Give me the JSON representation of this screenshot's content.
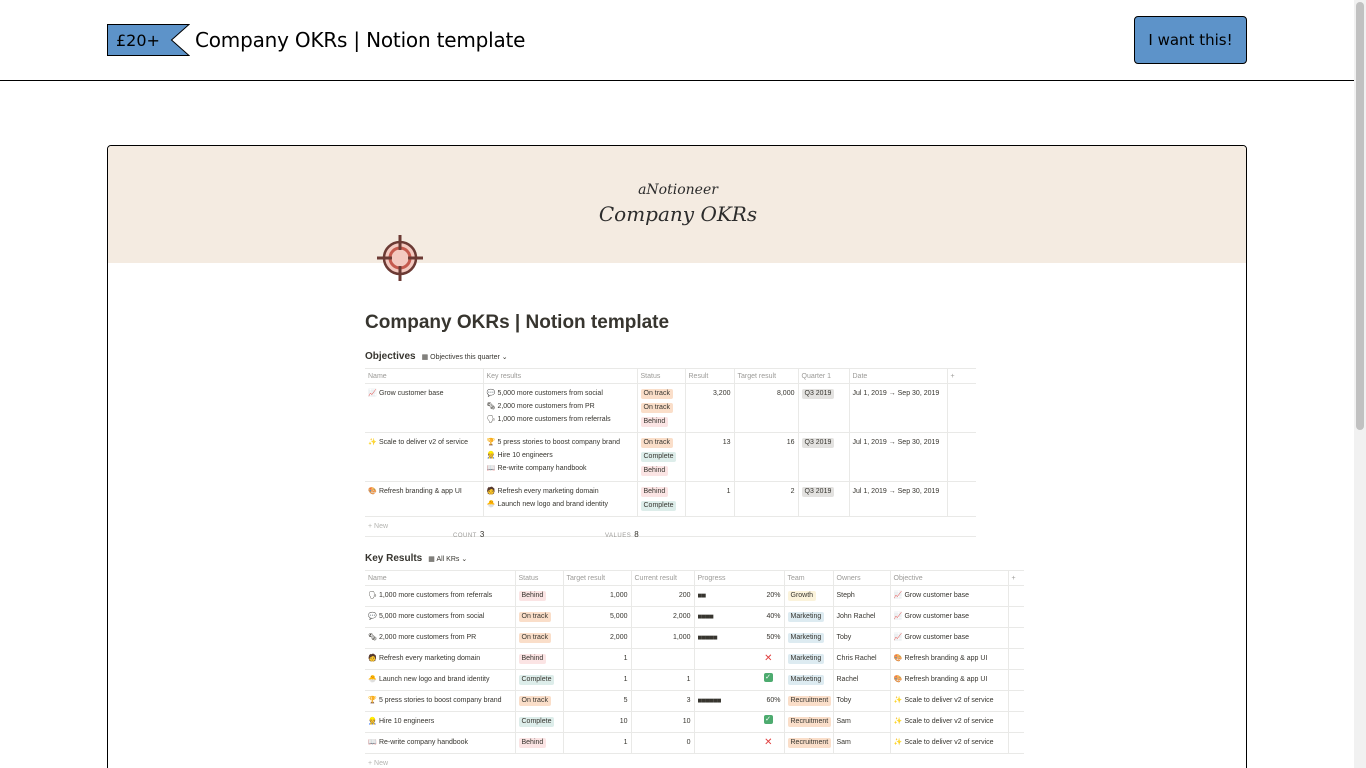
{
  "header": {
    "price": "£20+",
    "title": "Company OKRs | Notion template",
    "cta_label": "I want this!"
  },
  "colors": {
    "accent": "#5d93c9",
    "cover": "#f4ebe1",
    "behind": "#fbe4e4",
    "on_track": "#fadec9",
    "complete": "#ddedea"
  },
  "preview": {
    "cover_brand": "aNotioneer",
    "cover_title": "Company OKRs",
    "page_icon": "target-crosshair-icon",
    "page_title": "Company OKRs | Notion template",
    "objectives": {
      "name": "Objectives",
      "view": "Objectives this quarter",
      "columns": [
        "Name",
        "Key results",
        "Status",
        "Result",
        "Target result",
        "Quarter 1",
        "Date",
        "+"
      ],
      "rows": [
        {
          "name": "Grow customer base",
          "key_results": [
            "5,000 more customers from social",
            "2,000 more customers from PR",
            "1,000 more customers from referrals"
          ],
          "statuses": [
            "On track",
            "On track",
            "Behind"
          ],
          "result": "3,200",
          "target": "8,000",
          "quarter": "Q3 2019",
          "date": "Jul 1, 2019 → Sep 30, 2019"
        },
        {
          "name": "Scale to deliver v2 of service",
          "key_results": [
            "5 press stories to boost company brand",
            "Hire 10 engineers",
            "Re-write company handbook"
          ],
          "statuses": [
            "On track",
            "Complete",
            "Behind"
          ],
          "result": "13",
          "target": "16",
          "quarter": "Q3 2019",
          "date": "Jul 1, 2019 → Sep 30, 2019"
        },
        {
          "name": "Refresh branding & app UI",
          "key_results": [
            "Refresh every marketing domain",
            "Launch new logo and brand identity"
          ],
          "statuses": [
            "Behind",
            "Complete"
          ],
          "result": "1",
          "target": "2",
          "quarter": "Q3 2019",
          "date": "Jul 1, 2019 → Sep 30, 2019"
        }
      ],
      "new_label": "+ New",
      "count_label": "COUNT",
      "count_value": "3",
      "values_label": "VALUES",
      "values_value": "8"
    },
    "key_results": {
      "name": "Key Results",
      "view": "All KRs",
      "columns": [
        "Name",
        "Status",
        "Target result",
        "Current result",
        "Progress",
        "Team",
        "Owners",
        "Objective",
        "+"
      ],
      "rows": [
        {
          "name": "1,000 more customers from referrals",
          "status": "Behind",
          "target": "1,000",
          "current": "200",
          "bar": "■■",
          "pct": "20%",
          "mark": "",
          "team": "Growth",
          "owner": "Steph",
          "objective": "Grow customer base"
        },
        {
          "name": "5,000 more customers from social",
          "status": "On track",
          "target": "5,000",
          "current": "2,000",
          "bar": "■■■■",
          "pct": "40%",
          "mark": "",
          "team": "Marketing",
          "owner": "John Rachel",
          "objective": "Grow customer base"
        },
        {
          "name": "2,000 more customers from PR",
          "status": "On track",
          "target": "2,000",
          "current": "1,000",
          "bar": "■■■■■",
          "pct": "50%",
          "mark": "",
          "team": "Marketing",
          "owner": "Toby",
          "objective": "Grow customer base"
        },
        {
          "name": "Refresh every marketing domain",
          "status": "Behind",
          "target": "1",
          "current": "",
          "bar": "",
          "pct": "",
          "mark": "✕",
          "team": "Marketing",
          "owner": "Chris Rachel",
          "objective": "Refresh branding & app UI"
        },
        {
          "name": "Launch new logo and brand identity",
          "status": "Complete",
          "target": "1",
          "current": "1",
          "bar": "",
          "pct": "",
          "mark": "✓",
          "team": "Marketing",
          "owner": "Rachel",
          "objective": "Refresh branding & app UI"
        },
        {
          "name": "5 press stories to boost company brand",
          "status": "On track",
          "target": "5",
          "current": "3",
          "bar": "■■■■■■",
          "pct": "60%",
          "mark": "",
          "team": "Recruitment",
          "owner": "Toby",
          "objective": "Scale to deliver v2 of service"
        },
        {
          "name": "Hire 10 engineers",
          "status": "Complete",
          "target": "10",
          "current": "10",
          "bar": "",
          "pct": "",
          "mark": "✓",
          "team": "Recruitment",
          "owner": "Sam",
          "objective": "Scale to deliver v2 of service"
        },
        {
          "name": "Re-write company handbook",
          "status": "Behind",
          "target": "1",
          "current": "0",
          "bar": "",
          "pct": "",
          "mark": "✕",
          "team": "Recruitment",
          "owner": "Sam",
          "objective": "Scale to deliver v2 of service"
        }
      ],
      "new_label": "+ New"
    }
  }
}
